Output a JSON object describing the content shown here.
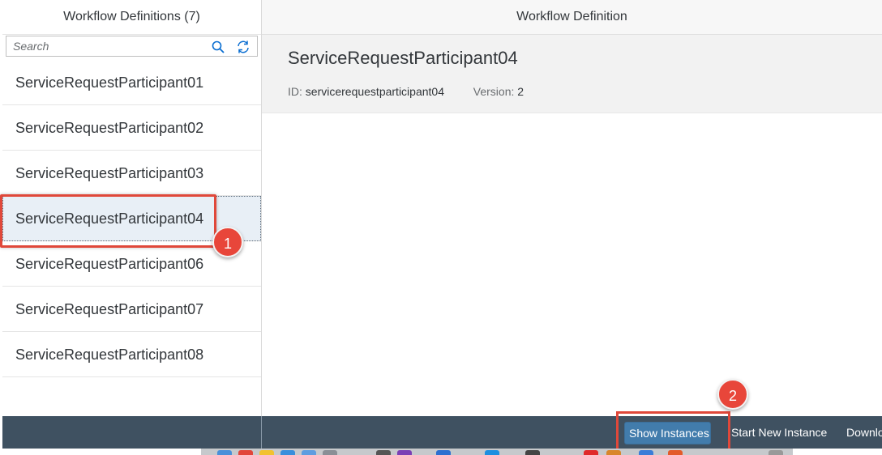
{
  "master": {
    "title": "Workflow Definitions (7)",
    "search_placeholder": "Search",
    "items": [
      {
        "label": "ServiceRequestParticipant01"
      },
      {
        "label": "ServiceRequestParticipant02"
      },
      {
        "label": "ServiceRequestParticipant03"
      },
      {
        "label": "ServiceRequestParticipant04",
        "selected": true
      },
      {
        "label": "ServiceRequestParticipant06"
      },
      {
        "label": "ServiceRequestParticipant07"
      },
      {
        "label": "ServiceRequestParticipant08"
      }
    ]
  },
  "detail": {
    "title": "Workflow Definition",
    "object_title": "ServiceRequestParticipant04",
    "id_label": "ID:",
    "id_value": "servicerequestparticipant04",
    "version_label": "Version:",
    "version_value": "2"
  },
  "footer": {
    "show_instances": "Show Instances",
    "start_new_instance": "Start New Instance",
    "download": "Downlo"
  },
  "annotations": {
    "step1": "1",
    "step2": "2"
  },
  "colors": {
    "accent": "#427cac",
    "footer_bg": "#3f5161",
    "highlight": "#e0483a",
    "selected_bg": "#e8eff6"
  },
  "icons": [
    "search-icon",
    "refresh-icon"
  ]
}
